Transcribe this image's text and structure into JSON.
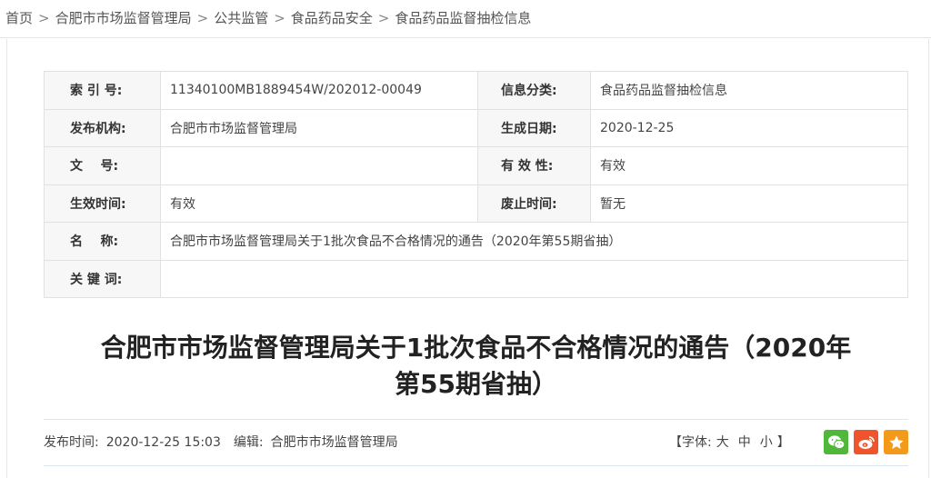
{
  "breadcrumb": {
    "items": [
      "首页",
      "合肥市市场监督管理局",
      "公共监管",
      "食品药品安全",
      "食品药品监督抽检信息"
    ],
    "separator": ">"
  },
  "meta": {
    "rows": [
      {
        "label1": "索 引 号:",
        "value1": "11340100MB1889454W/202012-00049",
        "label2": "信息分类:",
        "value2": "食品药品监督抽检信息"
      },
      {
        "label1": "发布机构:",
        "value1": "合肥市市场监督管理局",
        "label2": "生成日期:",
        "value2": "2020-12-25"
      },
      {
        "label1": "文    号:",
        "value1": "",
        "label2": "有 效 性:",
        "value2": "有效"
      },
      {
        "label1": "生效时间:",
        "value1": "有效",
        "label2": "废止时间:",
        "value2": "暂无"
      }
    ],
    "name_label": "名    称:",
    "name_value": "合肥市市场监督管理局关于1批次食品不合格情况的通告（2020年第55期省抽）",
    "keywords_label": "关 键 词:",
    "keywords_value": ""
  },
  "article": {
    "title_line1": "合肥市市场监督管理局关于1批次食品不合格情况的通告（2020年",
    "title_line2": "第55期省抽）"
  },
  "info": {
    "publish_label": "发布时间:",
    "publish_time": "2020-12-25 15:03",
    "editor_label": "编辑:",
    "editor": "合肥市市场监督管理局",
    "font_open": "【字体:",
    "font_large": "大",
    "font_medium": "中",
    "font_small": "小",
    "font_close": "】"
  },
  "share": {
    "icons": [
      "wechat-icon",
      "weibo-icon",
      "favorite-icon"
    ],
    "colors": {
      "wechat": "#4fb83a",
      "weibo": "#f0542c",
      "favorite": "#f39a1a"
    }
  }
}
